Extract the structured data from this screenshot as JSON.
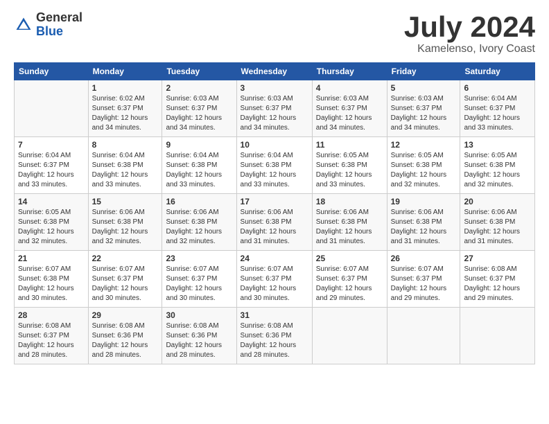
{
  "header": {
    "logo_general": "General",
    "logo_blue": "Blue",
    "month_year": "July 2024",
    "location": "Kamelenso, Ivory Coast"
  },
  "weekdays": [
    "Sunday",
    "Monday",
    "Tuesday",
    "Wednesday",
    "Thursday",
    "Friday",
    "Saturday"
  ],
  "weeks": [
    [
      {
        "day": "",
        "info": ""
      },
      {
        "day": "1",
        "info": "Sunrise: 6:02 AM\nSunset: 6:37 PM\nDaylight: 12 hours\nand 34 minutes."
      },
      {
        "day": "2",
        "info": "Sunrise: 6:03 AM\nSunset: 6:37 PM\nDaylight: 12 hours\nand 34 minutes."
      },
      {
        "day": "3",
        "info": "Sunrise: 6:03 AM\nSunset: 6:37 PM\nDaylight: 12 hours\nand 34 minutes."
      },
      {
        "day": "4",
        "info": "Sunrise: 6:03 AM\nSunset: 6:37 PM\nDaylight: 12 hours\nand 34 minutes."
      },
      {
        "day": "5",
        "info": "Sunrise: 6:03 AM\nSunset: 6:37 PM\nDaylight: 12 hours\nand 34 minutes."
      },
      {
        "day": "6",
        "info": "Sunrise: 6:04 AM\nSunset: 6:37 PM\nDaylight: 12 hours\nand 33 minutes."
      }
    ],
    [
      {
        "day": "7",
        "info": "Sunrise: 6:04 AM\nSunset: 6:37 PM\nDaylight: 12 hours\nand 33 minutes."
      },
      {
        "day": "8",
        "info": "Sunrise: 6:04 AM\nSunset: 6:38 PM\nDaylight: 12 hours\nand 33 minutes."
      },
      {
        "day": "9",
        "info": "Sunrise: 6:04 AM\nSunset: 6:38 PM\nDaylight: 12 hours\nand 33 minutes."
      },
      {
        "day": "10",
        "info": "Sunrise: 6:04 AM\nSunset: 6:38 PM\nDaylight: 12 hours\nand 33 minutes."
      },
      {
        "day": "11",
        "info": "Sunrise: 6:05 AM\nSunset: 6:38 PM\nDaylight: 12 hours\nand 33 minutes."
      },
      {
        "day": "12",
        "info": "Sunrise: 6:05 AM\nSunset: 6:38 PM\nDaylight: 12 hours\nand 32 minutes."
      },
      {
        "day": "13",
        "info": "Sunrise: 6:05 AM\nSunset: 6:38 PM\nDaylight: 12 hours\nand 32 minutes."
      }
    ],
    [
      {
        "day": "14",
        "info": "Sunrise: 6:05 AM\nSunset: 6:38 PM\nDaylight: 12 hours\nand 32 minutes."
      },
      {
        "day": "15",
        "info": "Sunrise: 6:06 AM\nSunset: 6:38 PM\nDaylight: 12 hours\nand 32 minutes."
      },
      {
        "day": "16",
        "info": "Sunrise: 6:06 AM\nSunset: 6:38 PM\nDaylight: 12 hours\nand 32 minutes."
      },
      {
        "day": "17",
        "info": "Sunrise: 6:06 AM\nSunset: 6:38 PM\nDaylight: 12 hours\nand 31 minutes."
      },
      {
        "day": "18",
        "info": "Sunrise: 6:06 AM\nSunset: 6:38 PM\nDaylight: 12 hours\nand 31 minutes."
      },
      {
        "day": "19",
        "info": "Sunrise: 6:06 AM\nSunset: 6:38 PM\nDaylight: 12 hours\nand 31 minutes."
      },
      {
        "day": "20",
        "info": "Sunrise: 6:06 AM\nSunset: 6:38 PM\nDaylight: 12 hours\nand 31 minutes."
      }
    ],
    [
      {
        "day": "21",
        "info": "Sunrise: 6:07 AM\nSunset: 6:38 PM\nDaylight: 12 hours\nand 30 minutes."
      },
      {
        "day": "22",
        "info": "Sunrise: 6:07 AM\nSunset: 6:37 PM\nDaylight: 12 hours\nand 30 minutes."
      },
      {
        "day": "23",
        "info": "Sunrise: 6:07 AM\nSunset: 6:37 PM\nDaylight: 12 hours\nand 30 minutes."
      },
      {
        "day": "24",
        "info": "Sunrise: 6:07 AM\nSunset: 6:37 PM\nDaylight: 12 hours\nand 30 minutes."
      },
      {
        "day": "25",
        "info": "Sunrise: 6:07 AM\nSunset: 6:37 PM\nDaylight: 12 hours\nand 29 minutes."
      },
      {
        "day": "26",
        "info": "Sunrise: 6:07 AM\nSunset: 6:37 PM\nDaylight: 12 hours\nand 29 minutes."
      },
      {
        "day": "27",
        "info": "Sunrise: 6:08 AM\nSunset: 6:37 PM\nDaylight: 12 hours\nand 29 minutes."
      }
    ],
    [
      {
        "day": "28",
        "info": "Sunrise: 6:08 AM\nSunset: 6:37 PM\nDaylight: 12 hours\nand 28 minutes."
      },
      {
        "day": "29",
        "info": "Sunrise: 6:08 AM\nSunset: 6:36 PM\nDaylight: 12 hours\nand 28 minutes."
      },
      {
        "day": "30",
        "info": "Sunrise: 6:08 AM\nSunset: 6:36 PM\nDaylight: 12 hours\nand 28 minutes."
      },
      {
        "day": "31",
        "info": "Sunrise: 6:08 AM\nSunset: 6:36 PM\nDaylight: 12 hours\nand 28 minutes."
      },
      {
        "day": "",
        "info": ""
      },
      {
        "day": "",
        "info": ""
      },
      {
        "day": "",
        "info": ""
      }
    ]
  ]
}
